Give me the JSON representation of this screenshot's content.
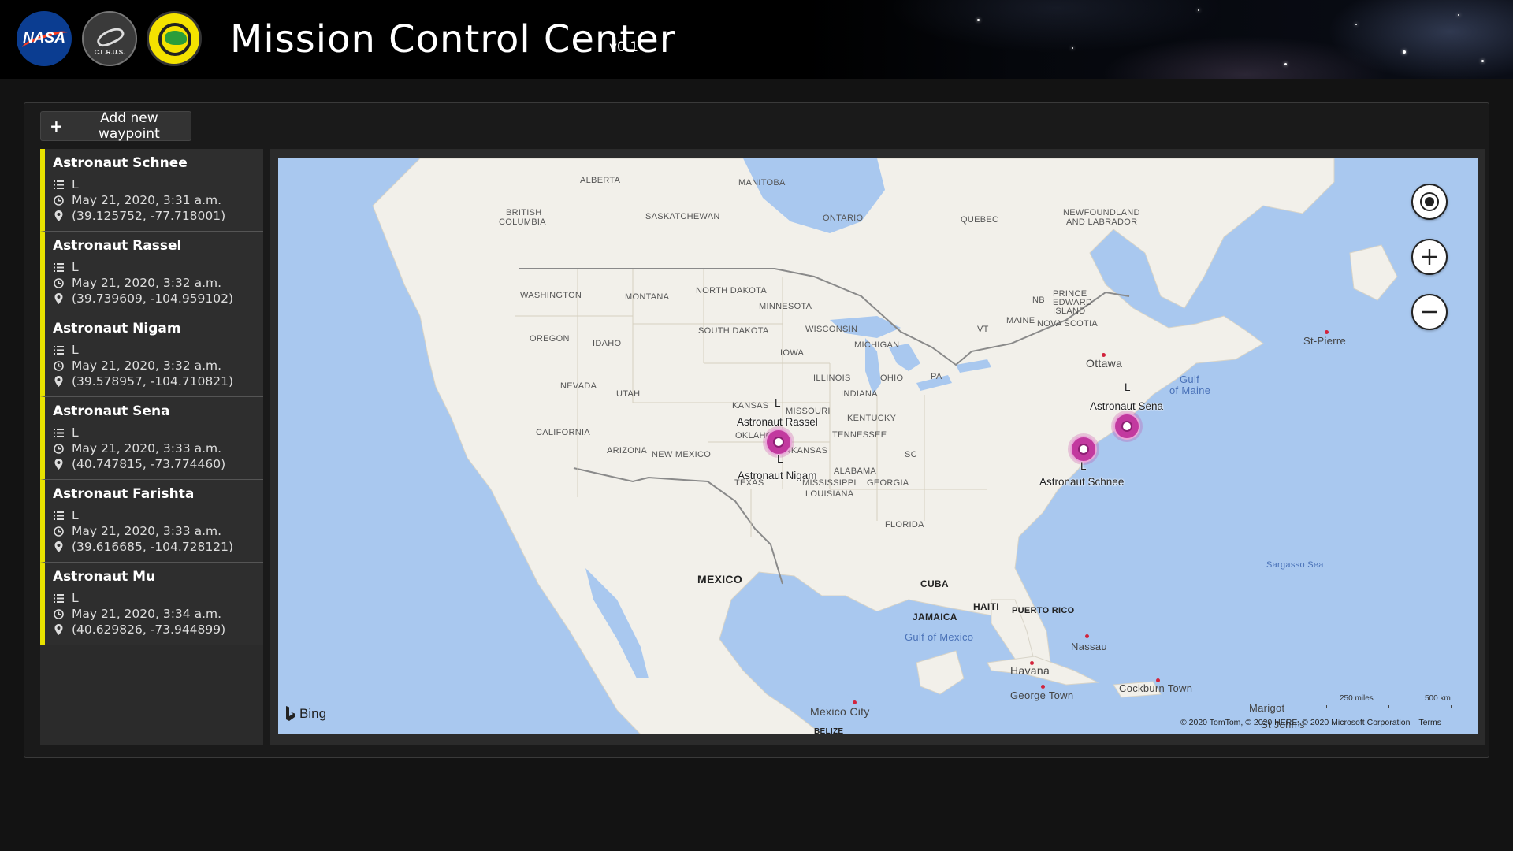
{
  "header": {
    "title": "Mission Control Center",
    "version": "v0.1",
    "logos": {
      "nasa": "NASA",
      "clr": "C.L.R.U.S."
    }
  },
  "toolbar": {
    "add_waypoint_label": "Add new waypoint"
  },
  "waypoints": [
    {
      "name": "Astronaut Schnee",
      "type": "L",
      "time": "May 21, 2020, 3:31 a.m.",
      "coords": "(39.125752, -77.718001)"
    },
    {
      "name": "Astronaut Rassel",
      "type": "L",
      "time": "May 21, 2020, 3:32 a.m.",
      "coords": "(39.739609, -104.959102)"
    },
    {
      "name": "Astronaut Nigam",
      "type": "L",
      "time": "May 21, 2020, 3:32 a.m.",
      "coords": "(39.578957, -104.710821)"
    },
    {
      "name": "Astronaut Sena",
      "type": "L",
      "time": "May 21, 2020, 3:33 a.m.",
      "coords": "(40.747815, -73.774460)"
    },
    {
      "name": "Astronaut Farishta",
      "type": "L",
      "time": "May 21, 2020, 3:33 a.m.",
      "coords": "(39.616685, -104.728121)"
    },
    {
      "name": "Astronaut Mu",
      "type": "L",
      "time": "May 21, 2020, 3:34 a.m.",
      "coords": "(40.629826, -73.944899)"
    }
  ],
  "map": {
    "provider": "Bing",
    "copyright": "© 2020 TomTom, © 2020 HERE, © 2020 Microsoft Corporation",
    "terms": "Terms",
    "scale_miles": "250 miles",
    "scale_km": "500 km",
    "pins": {
      "rassel": {
        "name": "Astronaut Rassel",
        "type": "L"
      },
      "nigam": {
        "name": "Astronaut Nigam",
        "type": "L"
      },
      "sena": {
        "name": "Astronaut Sena",
        "type": "L"
      },
      "schnee": {
        "name": "Astronaut Schnee",
        "type": "L"
      }
    },
    "labels": {
      "alberta": "ALBERTA",
      "manitoba": "MANITOBA",
      "british_columbia_1": "BRITISH",
      "british_columbia_2": "COLUMBIA",
      "saskatchewan": "SASKATCHEWAN",
      "ontario": "ONTARIO",
      "quebec": "QUEBEC",
      "newfoundland_1": "NEWFOUNDLAND",
      "newfoundland_2": "AND LABRADOR",
      "washington": "WASHINGTON",
      "montana": "MONTANA",
      "north_dakota": "NORTH DAKOTA",
      "minnesota": "MINNESOTA",
      "oregon": "OREGON",
      "idaho": "IDAHO",
      "south_dakota": "SOUTH DAKOTA",
      "wisconsin": "WISCONSIN",
      "michigan": "MICHIGAN",
      "iowa": "IOWA",
      "nevada": "NEVADA",
      "utah": "UTAH",
      "illinois": "ILLINOIS",
      "ohio": "OHIO",
      "pa": "PA",
      "indiana": "INDIANA",
      "kansas": "KANSAS",
      "missouri": "MISSOURI",
      "kentucky": "KENTUCKY",
      "california": "CALIFORNIA",
      "oklahoma": "OKLAHOMA",
      "tennessee": "TENNESSEE",
      "arizona": "ARIZONA",
      "new_mexico": "NEW MEXICO",
      "arkansas": "ARKANSAS",
      "sc": "SC",
      "alabama": "ALABAMA",
      "texas": "TEXAS",
      "mississippi": "MISSISSIPPI",
      "georgia": "GEORGIA",
      "louisiana": "LOUISIANA",
      "florida": "FLORIDA",
      "vt": "VT",
      "maine": "MAINE",
      "nb": "NB",
      "pei_1": "PRINCE",
      "pei_2": "EDWARD",
      "pei_3": "ISLAND",
      "nova_scotia": "NOVA SCOTIA",
      "mexico": "MEXICO",
      "cuba": "CUBA",
      "haiti": "HAITI",
      "jamaica": "JAMAICA",
      "puerto_rico": "PUERTO RICO",
      "belize": "BELIZE",
      "ottawa": "Ottawa",
      "st_pierre": "St-Pierre",
      "nassau": "Nassau",
      "havana": "Havana",
      "george_town": "George Town",
      "cockburn_town": "Cockburn Town",
      "mexico_city": "Mexico City",
      "marigot": "Marigot",
      "st_johns": "St John's",
      "gulf_of_mexico": "Gulf of Mexico",
      "gulf_of_maine_1": "Gulf",
      "gulf_of_maine_2": "of Maine",
      "sargasso_sea": "Sargasso Sea"
    }
  },
  "colors": {
    "accent": "#e8e200",
    "pin": "#c2399f",
    "water": "#a9c8ef",
    "land": "#f2f0ea"
  }
}
